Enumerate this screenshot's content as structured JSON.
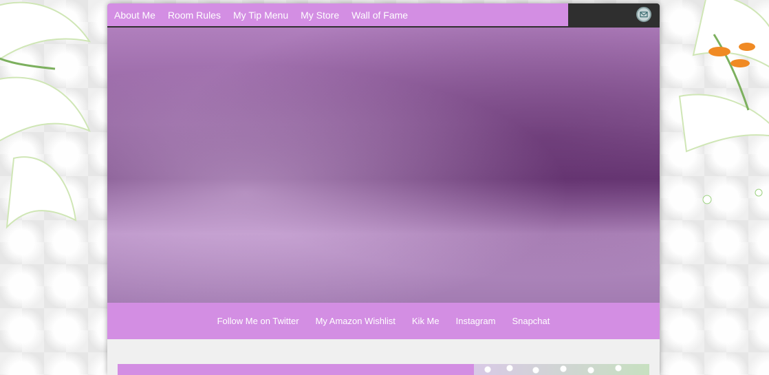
{
  "colors": {
    "accent": "#d38ee3",
    "dark_bar": "#2f2f2f",
    "page_bg": "#f0f0f0"
  },
  "top_nav": {
    "items": [
      {
        "label": "About Me"
      },
      {
        "label": "Room Rules"
      },
      {
        "label": "My Tip Menu"
      },
      {
        "label": "My Store"
      },
      {
        "label": "Wall of Fame"
      }
    ],
    "mail_icon": "mail-icon"
  },
  "sub_nav": {
    "items": [
      {
        "label": "Follow Me on Twitter"
      },
      {
        "label": "My Amazon Wishlist"
      },
      {
        "label": "Kik Me"
      },
      {
        "label": "Instagram"
      },
      {
        "label": "Snapchat"
      }
    ]
  }
}
